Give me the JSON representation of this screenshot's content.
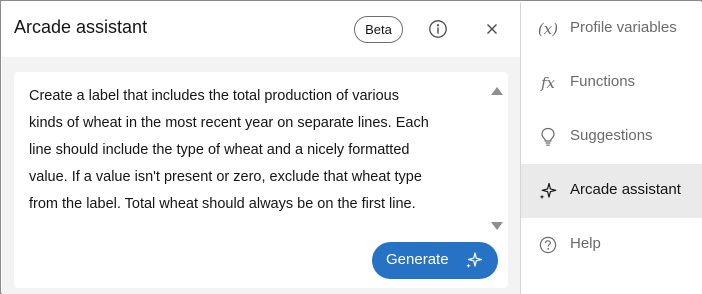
{
  "assistant": {
    "title": "Arcade assistant",
    "badge": "Beta",
    "prompt": "Create a label that includes the total production of various\nkinds of wheat in the most recent year on separate lines. Each\nline should include the type of wheat and a nicely formatted\nvalue. If a value isn't present or zero, exclude that wheat type\nfrom the label. Total wheat should always be on the first line.",
    "generate_label": "Generate"
  },
  "side_nav": {
    "items": [
      {
        "label": "Profile variables",
        "icon": "(x)"
      },
      {
        "label": "Functions",
        "icon": "fx"
      },
      {
        "label": "Suggestions",
        "icon": "lightbulb-icon"
      },
      {
        "label": "Arcade assistant",
        "icon": "sparkle-icon",
        "active": true
      },
      {
        "label": "Help",
        "icon": "question-circle-icon"
      }
    ]
  },
  "colors": {
    "accent": "#2672c5",
    "panel_bg": "#f3f3f3",
    "active_nav_bg": "#eaeaea",
    "text": "#151515",
    "muted_text": "#6a6a6a"
  }
}
